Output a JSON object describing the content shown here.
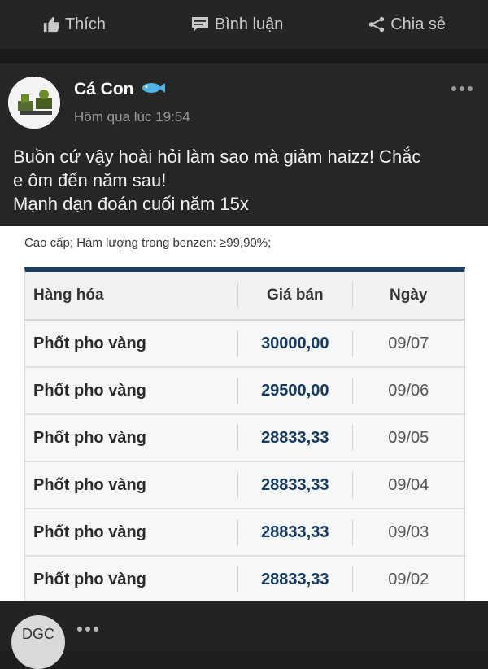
{
  "actions": {
    "like": "Thích",
    "comment": "Bình luận",
    "share": "Chia sẻ"
  },
  "post": {
    "author": "Cá Con",
    "time": "Hôm qua lúc 19:54",
    "text_lines": [
      "Buồn cứ vậy hoài hỏi làm sao mà giảm haizz! Chắc",
      "e ôm đến năm sau!",
      "Mạnh dạn đoán cuối năm 15x"
    ]
  },
  "image": {
    "caption": "Cao cấp; Hàm lượng trong benzen: ≥99,90%;",
    "headers": [
      "Hàng hóa",
      "Giá bán",
      "Ngày"
    ],
    "rows": [
      [
        "Phốt pho vàng",
        "30000,00",
        "09/07"
      ],
      [
        "Phốt pho vàng",
        "29500,00",
        "09/06"
      ],
      [
        "Phốt pho vàng",
        "28833,33",
        "09/05"
      ],
      [
        "Phốt pho vàng",
        "28833,33",
        "09/04"
      ],
      [
        "Phốt pho vàng",
        "28833,33",
        "09/03"
      ],
      [
        "Phốt pho vàng",
        "28833,33",
        "09/02"
      ]
    ]
  },
  "bottom": {
    "avatar_text": "DGC"
  },
  "colors": {
    "background": "#1e1e1e",
    "table_header_bar": "#1c3d5e",
    "price_text": "#163a61"
  },
  "icons": [
    "thumbs-up-icon",
    "comment-icon",
    "share-icon",
    "fish-icon",
    "more-icon"
  ]
}
